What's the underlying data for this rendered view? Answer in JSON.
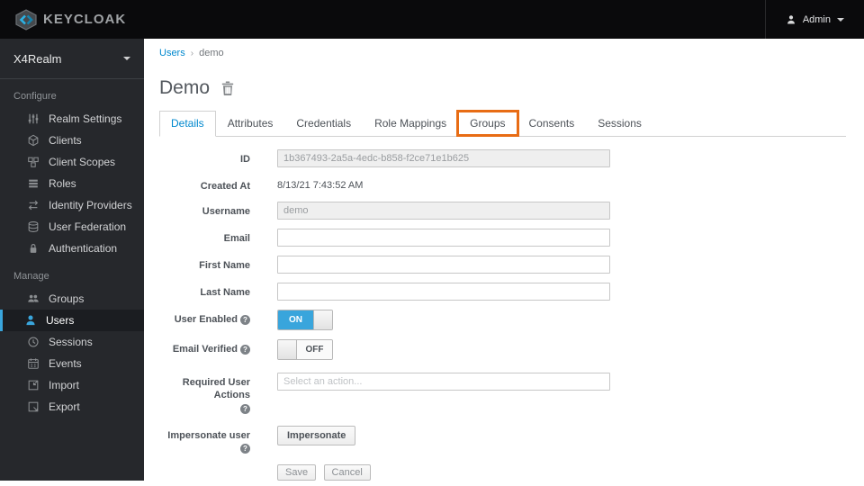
{
  "topbar": {
    "brand": "KEYCLOAK",
    "user_menu": {
      "label": "Admin"
    }
  },
  "sidebar": {
    "realm": "X4Realm",
    "sections": [
      {
        "label": "Configure",
        "items": [
          {
            "label": "Realm Settings",
            "icon": "sliders-icon"
          },
          {
            "label": "Clients",
            "icon": "cube-icon"
          },
          {
            "label": "Client Scopes",
            "icon": "cubes-icon"
          },
          {
            "label": "Roles",
            "icon": "list-rows-icon"
          },
          {
            "label": "Identity Providers",
            "icon": "exchange-arrows-icon"
          },
          {
            "label": "User Federation",
            "icon": "database-icon"
          },
          {
            "label": "Authentication",
            "icon": "lock-icon"
          }
        ]
      },
      {
        "label": "Manage",
        "items": [
          {
            "label": "Groups",
            "icon": "group-icon"
          },
          {
            "label": "Users",
            "icon": "user-icon",
            "active": true
          },
          {
            "label": "Sessions",
            "icon": "clock-icon"
          },
          {
            "label": "Events",
            "icon": "calendar-icon"
          },
          {
            "label": "Import",
            "icon": "import-icon"
          },
          {
            "label": "Export",
            "icon": "export-icon"
          }
        ]
      }
    ]
  },
  "breadcrumb": {
    "link": "Users",
    "separator": "›",
    "current": "demo"
  },
  "page": {
    "title": "Demo"
  },
  "tabs": [
    {
      "label": "Details",
      "active": true
    },
    {
      "label": "Attributes"
    },
    {
      "label": "Credentials"
    },
    {
      "label": "Role Mappings"
    },
    {
      "label": "Groups",
      "highlighted": true
    },
    {
      "label": "Consents"
    },
    {
      "label": "Sessions"
    }
  ],
  "form": {
    "id": {
      "label": "ID",
      "value": "1b367493-2a5a-4edc-b858-f2ce71e1b625"
    },
    "created_at": {
      "label": "Created At",
      "value": "8/13/21 7:43:52 AM"
    },
    "username": {
      "label": "Username",
      "value": "demo"
    },
    "email": {
      "label": "Email",
      "value": ""
    },
    "first_name": {
      "label": "First Name",
      "value": ""
    },
    "last_name": {
      "label": "Last Name",
      "value": ""
    },
    "user_enabled": {
      "label": "User Enabled",
      "state": "ON"
    },
    "email_verified": {
      "label": "Email Verified",
      "state": "OFF"
    },
    "required_user_actions": {
      "label": "Required User Actions",
      "placeholder": "Select an action..."
    },
    "impersonate": {
      "label": "Impersonate user",
      "button_label": "Impersonate"
    },
    "actions": {
      "save": "Save",
      "cancel": "Cancel"
    }
  },
  "ui": {
    "help_glyph": "?"
  },
  "colors": {
    "accent_blue": "#0088ce",
    "toggle_on_blue": "#39a5dc",
    "sidebar_active_blue": "#39a5dc",
    "highlight_orange": "#e86c14",
    "topbar_black": "#0a0a0c",
    "sidebar_dark": "#26282c"
  }
}
